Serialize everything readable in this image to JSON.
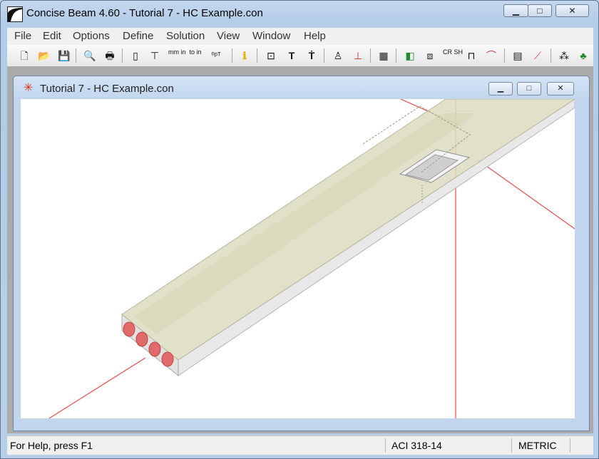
{
  "window": {
    "title": "Concise Beam 4.60 - Tutorial 7 - HC Example.con",
    "minimize": "▁",
    "maximize": "□",
    "close": "✕"
  },
  "menu": [
    "File",
    "Edit",
    "Options",
    "Define",
    "Solution",
    "View",
    "Window",
    "Help"
  ],
  "toolbar": {
    "new": "🗋",
    "open": "📂",
    "save": "💾",
    "print_preview": "🔍",
    "print": "🖶",
    "units_book": "▯",
    "units_table": "⊤",
    "mm_in": "mm in",
    "to_in": "to in",
    "pt": "⁰ᵖᵀ",
    "info": "ℹ",
    "grid": "⊡",
    "beam_t": "T",
    "beam_section": "Ṫ",
    "load_person": "♙",
    "load_point": "⊥",
    "calculator": "▦",
    "stress": "◧",
    "strands": "⧈",
    "cr_sh": "CR SH",
    "stirrup": "⊓",
    "camber": "⌒",
    "report": "▤",
    "chart": "⟋",
    "shear_graph": "⁂",
    "tree": "♣"
  },
  "document": {
    "title": "Tutorial 7 - HC Example.con",
    "icon": "✳",
    "minimize": "▁",
    "maximize": "□",
    "close": "✕"
  },
  "status": {
    "help": "For Help, press F1",
    "code": "ACI 318-14",
    "units": "METRIC"
  },
  "colors": {
    "axis_red": "#e84c4c",
    "slab_top": "#dcdcbf",
    "slab_side": "#e4e4e4",
    "void": "#e36a6a"
  }
}
